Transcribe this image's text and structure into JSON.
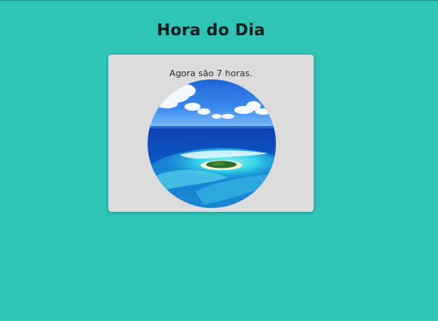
{
  "page": {
    "title": "Hora do Dia",
    "message": "Agora são 7 horas.",
    "background_color": "#2ec4b6",
    "card_color": "#dcdcdc"
  },
  "image": {
    "subject": "tropical-island-aerial-photo",
    "shape": "circle"
  }
}
